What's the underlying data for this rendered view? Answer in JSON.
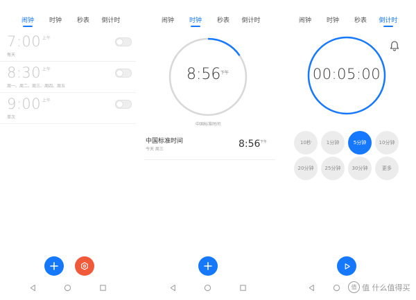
{
  "tabs": [
    "闹钟",
    "时钟",
    "秒表",
    "倒计时"
  ],
  "colors": {
    "accent": "#1677ff",
    "settings": "#f05a3a"
  },
  "alarms": [
    {
      "time": "7:00",
      "ampm": "上午",
      "repeat": "每天"
    },
    {
      "time": "8:30",
      "ampm": "上午",
      "repeat": "周一、周二、周三、周四、周五"
    },
    {
      "time": "9:00",
      "ampm": "上午",
      "repeat": "单次"
    }
  ],
  "clock": {
    "time": "8:56",
    "ampm": "下午",
    "timezone": "中国标准时间",
    "city": {
      "name": "中国标准时间",
      "sub": "今天 周三",
      "time": "8:56",
      "ampm": "下午"
    },
    "progress": 0.155
  },
  "timer": {
    "display": "00:05:00",
    "presets": [
      "10秒",
      "1分钟",
      "5分钟",
      "10分钟",
      "20分钟",
      "25分钟",
      "30分钟",
      "更多"
    ],
    "selected_index": 2
  },
  "icons": {
    "add": "plus-icon",
    "settings": "gear-icon",
    "play": "play-icon",
    "bell": "bell-icon",
    "back": "triangle-back-icon",
    "home": "circle-home-icon",
    "recents": "square-recents-icon"
  },
  "watermark": "值 什么值得买"
}
